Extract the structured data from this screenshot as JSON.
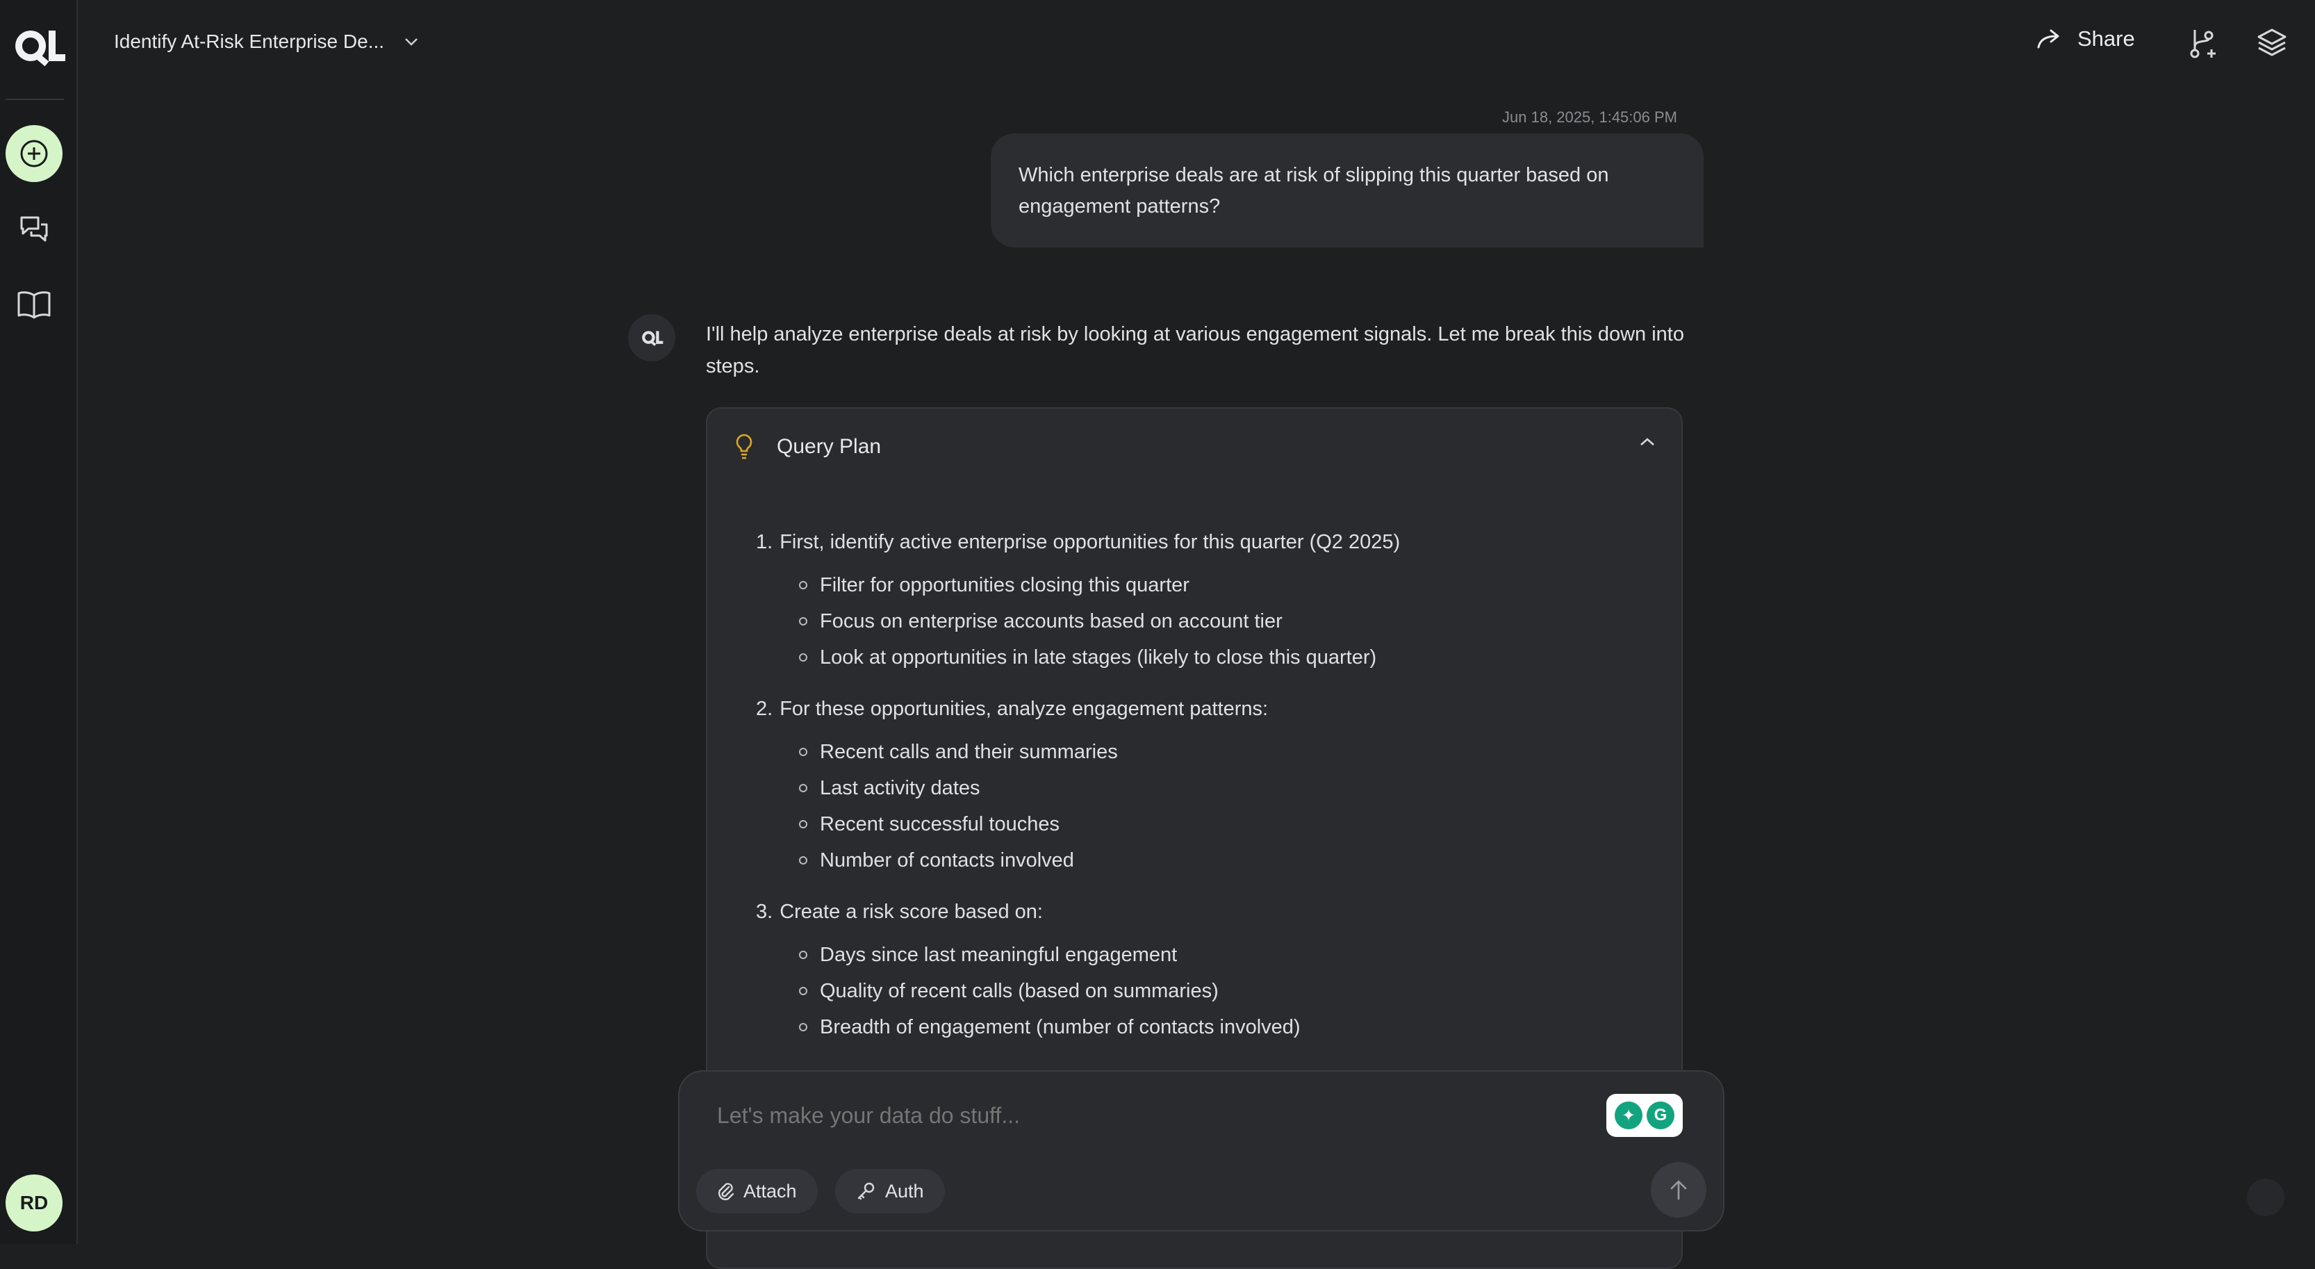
{
  "sidebar": {
    "user_initials": "RD"
  },
  "header": {
    "title": "Identify At-Risk Enterprise De...",
    "share_label": "Share"
  },
  "conversation": {
    "user_message": {
      "timestamp": "Jun 18, 2025, 1:45:06 PM",
      "text": "Which enterprise deals are at risk of slipping this quarter based on engagement patterns?"
    },
    "assistant_message": {
      "text": "I'll help analyze enterprise deals at risk by looking at various engagement signals. Let me break this down into steps."
    },
    "query_plan": {
      "title": "Query Plan",
      "steps": [
        {
          "num": "1.",
          "text": "First, identify active enterprise opportunities for this quarter (Q2 2025)",
          "items": [
            "Filter for opportunities closing this quarter",
            "Focus on enterprise accounts based on account tier",
            "Look at opportunities in late stages (likely to close this quarter)"
          ]
        },
        {
          "num": "2.",
          "text": "For these opportunities, analyze engagement patterns:",
          "items": [
            "Recent calls and their summaries",
            "Last activity dates",
            "Recent successful touches",
            "Number of contacts involved"
          ]
        },
        {
          "num": "3.",
          "text": "Create a risk score based on:",
          "items": [
            "Days since last meaningful engagement",
            "Quality of recent calls (based on summaries)",
            "Breadth of engagement (number of contacts involved)"
          ]
        }
      ]
    }
  },
  "composer": {
    "placeholder": "Let's make your data do stuff...",
    "attach_label": "Attach",
    "auth_label": "Auth"
  },
  "colors": {
    "background": "#1e1f21",
    "accent": "#d5f5c8",
    "bulb": "#e0a820",
    "grammarly": "#12a37f"
  }
}
